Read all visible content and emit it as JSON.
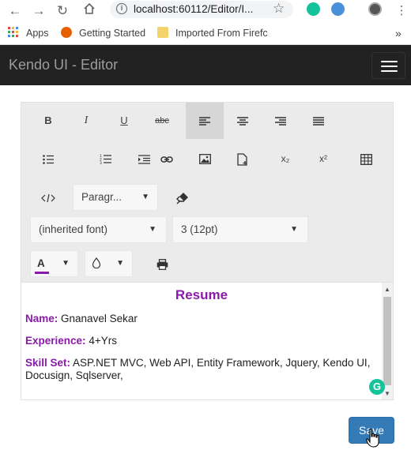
{
  "browser": {
    "url": "localhost:60112/Editor/I...",
    "bookmarks": {
      "apps": "Apps",
      "getting_started": "Getting Started",
      "imported": "Imported From Firefc"
    }
  },
  "navbar": {
    "brand": "Kendo UI - Editor"
  },
  "toolbar": {
    "bold": "B",
    "italic": "I",
    "underline": "U",
    "strike": "abc",
    "format_block": "Paragr...",
    "font_name": "(inherited font)",
    "font_size": "3 (12pt)",
    "fore_color_letter": "A",
    "subscript": "x₂",
    "superscript": "x²"
  },
  "content": {
    "title": "Resume",
    "name_label": "Name:",
    "name_value": "Gnanavel Sekar",
    "experience_label": "Experience:",
    "experience_value": "4+Yrs",
    "skills_label": "Skill Set:",
    "skills_value": "ASP.NET MVC, Web API, Entity Framework, Jquery, Kendo UI, Docusign, Sqlserver,"
  },
  "save_label": "Save",
  "colors": {
    "accent": "#8a1aa8",
    "navbar": "#222222",
    "save": "#337ab7",
    "fore_color_bar": "#8a1aa8"
  }
}
